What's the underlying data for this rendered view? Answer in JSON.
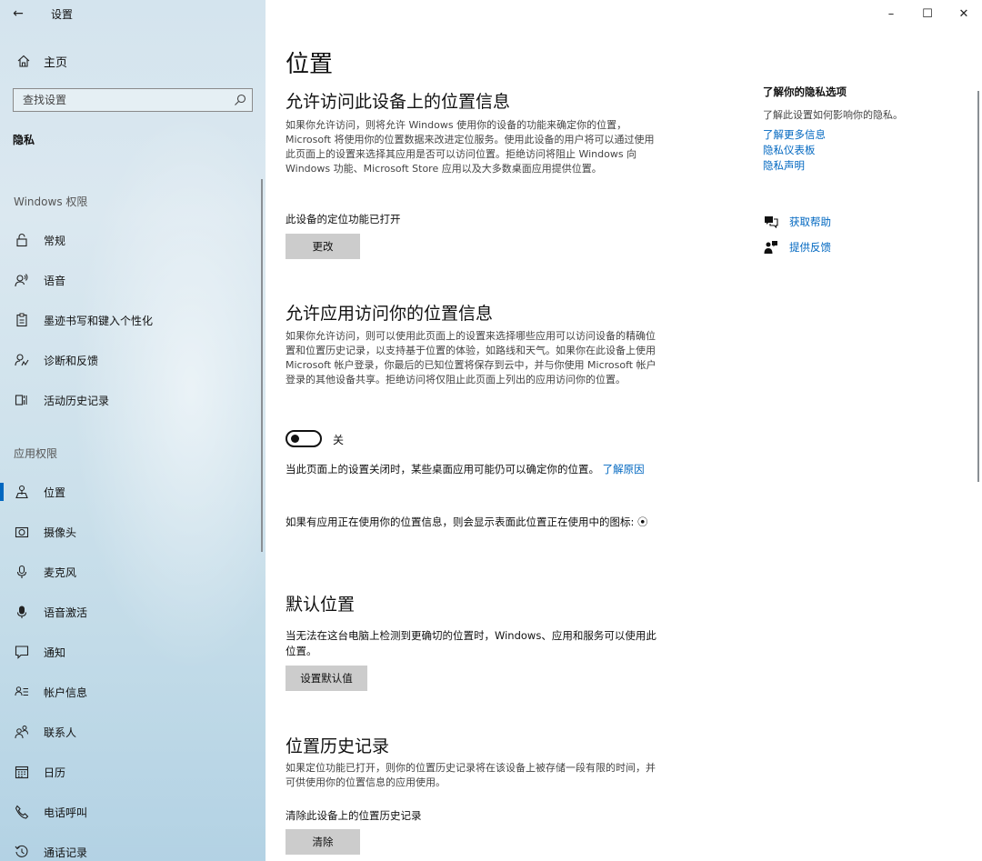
{
  "window": {
    "title": "设置",
    "back_glyph": "←",
    "minimize_glyph": "–",
    "maximize_glyph": "☐",
    "close_glyph": "✕"
  },
  "sidebar": {
    "home_label": "主页",
    "search_placeholder": "查找设置",
    "category": "隐私",
    "windows_permissions_heading": "Windows 权限",
    "windows_items": [
      {
        "label": "常规",
        "icon": "lock-icon"
      },
      {
        "label": "语音",
        "icon": "speech-icon"
      },
      {
        "label": "墨迹书写和键入个性化",
        "icon": "clipboard-icon"
      },
      {
        "label": "诊断和反馈",
        "icon": "diagnostics-icon"
      },
      {
        "label": "活动历史记录",
        "icon": "timeline-icon"
      }
    ],
    "app_permissions_heading": "应用权限",
    "app_items": [
      {
        "label": "位置",
        "icon": "location-icon",
        "active": true
      },
      {
        "label": "摄像头",
        "icon": "camera-icon"
      },
      {
        "label": "麦克风",
        "icon": "microphone-icon"
      },
      {
        "label": "语音激活",
        "icon": "voice-activation-icon"
      },
      {
        "label": "通知",
        "icon": "notification-icon"
      },
      {
        "label": "帐户信息",
        "icon": "account-info-icon"
      },
      {
        "label": "联系人",
        "icon": "contacts-icon"
      },
      {
        "label": "日历",
        "icon": "calendar-icon"
      },
      {
        "label": "电话呼叫",
        "icon": "phone-icon"
      },
      {
        "label": "通话记录",
        "icon": "call-history-icon"
      }
    ]
  },
  "main": {
    "page_title": "位置",
    "device_section": {
      "heading": "允许访问此设备上的位置信息",
      "description": "如果你允许访问，则将允许 Windows 使用你的设备的功能来确定你的位置，Microsoft 将使用你的位置数据来改进定位服务。使用此设备的用户将可以通过使用此页面上的设置来选择其应用是否可以访问位置。拒绝访问将阻止 Windows 向 Windows 功能、Microsoft Store 应用以及大多数桌面应用提供位置。",
      "status": "此设备的定位功能已打开",
      "change_button": "更改"
    },
    "app_section": {
      "heading": "允许应用访问你的位置信息",
      "description": "如果你允许访问，则可以使用此页面上的设置来选择哪些应用可以访问设备的精确位置和位置历史记录，以支持基于位置的体验，如路线和天气。如果你在此设备上使用 Microsoft 帐户登录，你最后的已知位置将保存到云中，并与你使用 Microsoft 帐户登录的其他设备共享。拒绝访问将仅阻止此页面上列出的应用访问你的位置。",
      "toggle_state": "关",
      "toggle_on": false,
      "note1": "当此页面上的设置关闭时，某些桌面应用可能仍可以确定你的位置。",
      "note1_link": "了解原因",
      "note2": "如果有应用正在使用你的位置信息，则会显示表面此位置正在使用中的图标:",
      "note2_icon_glyph": "⦿"
    },
    "default_section": {
      "heading": "默认位置",
      "description": "当无法在这台电脑上检测到更确切的位置时，Windows、应用和服务可以使用此位置。",
      "button": "设置默认值"
    },
    "history_section": {
      "heading": "位置历史记录",
      "description": "如果定位功能已打开，则你的位置历史记录将在该设备上被存储一段有限的时间，并可供使用你的位置信息的应用使用。",
      "clear_label": "清除此设备上的位置历史记录",
      "clear_button": "清除"
    }
  },
  "right": {
    "privacy_heading": "了解你的隐私选项",
    "privacy_text": "了解此设置如何影响你的隐私。",
    "links": [
      "了解更多信息",
      "隐私仪表板",
      "隐私声明"
    ],
    "get_help": "获取帮助",
    "give_feedback": "提供反馈"
  },
  "colors": {
    "accent": "#0067c0",
    "button_bg": "#cccccc"
  }
}
